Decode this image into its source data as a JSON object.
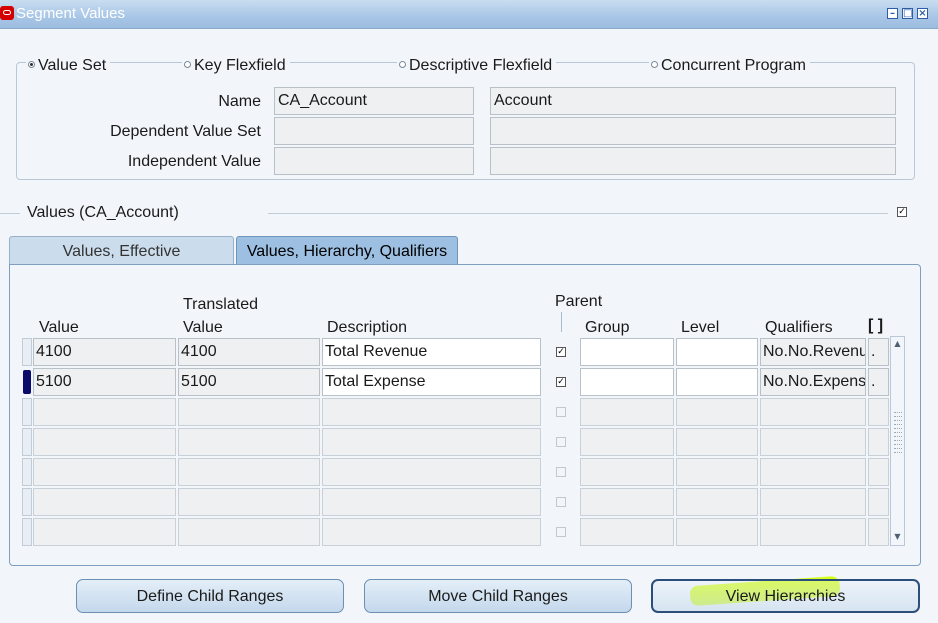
{
  "window": {
    "title": "Segment Values",
    "controls": [
      "minimize",
      "restore",
      "close"
    ]
  },
  "selection": {
    "radios": [
      {
        "label": "Value Set",
        "checked": true
      },
      {
        "label": "Key Flexfield",
        "checked": false
      },
      {
        "label": "Descriptive Flexfield",
        "checked": false
      },
      {
        "label": "Concurrent Program",
        "checked": false
      }
    ],
    "name_label": "Name",
    "name_value": "CA_Account",
    "name_description": "Account",
    "dependent_label": "Dependent Value Set",
    "dependent_value": "",
    "dependent_description": "",
    "independent_label": "Independent Value",
    "independent_value": "",
    "independent_description": ""
  },
  "values_section": {
    "title": "Values (CA_Account)",
    "checkbox_checked": true
  },
  "tabs": [
    {
      "label": "Values, Effective",
      "active": false
    },
    {
      "label": "Values, Hierarchy, Qualifiers",
      "active": true
    }
  ],
  "table": {
    "headers": {
      "value": "Value",
      "translated_top": "Translated",
      "translated_bottom": "Value",
      "description": "Description",
      "parent": "Parent",
      "group": "Group",
      "level": "Level",
      "qualifiers": "Qualifiers",
      "folder": "[ ]"
    },
    "rows": [
      {
        "value": "4100",
        "translated": "4100",
        "description": "Total Revenue",
        "parent": true,
        "group": "",
        "level": "",
        "qualifiers": "No.No.Revenue",
        "extra": ".",
        "current": false
      },
      {
        "value": "5100",
        "translated": "5100",
        "description": "Total Expense",
        "parent": true,
        "group": "",
        "level": "",
        "qualifiers": "No.No.Expense",
        "extra": ".",
        "current": true
      },
      {
        "value": "",
        "translated": "",
        "description": "",
        "parent": false,
        "group": "",
        "level": "",
        "qualifiers": "",
        "extra": "",
        "current": false
      },
      {
        "value": "",
        "translated": "",
        "description": "",
        "parent": false,
        "group": "",
        "level": "",
        "qualifiers": "",
        "extra": "",
        "current": false
      },
      {
        "value": "",
        "translated": "",
        "description": "",
        "parent": false,
        "group": "",
        "level": "",
        "qualifiers": "",
        "extra": "",
        "current": false
      },
      {
        "value": "",
        "translated": "",
        "description": "",
        "parent": false,
        "group": "",
        "level": "",
        "qualifiers": "",
        "extra": "",
        "current": false
      },
      {
        "value": "",
        "translated": "",
        "description": "",
        "parent": false,
        "group": "",
        "level": "",
        "qualifiers": "",
        "extra": "",
        "current": false
      }
    ]
  },
  "buttons": {
    "define_child_ranges": "Define Child Ranges",
    "move_child_ranges": "Move Child Ranges",
    "view_hierarchies": "View Hierarchies"
  },
  "colors": {
    "title_bar": "#a8c6e6",
    "active_tab": "#9cbfe2",
    "highlight": "#d2ff00",
    "current_row_marker": "#0a0a6a"
  }
}
